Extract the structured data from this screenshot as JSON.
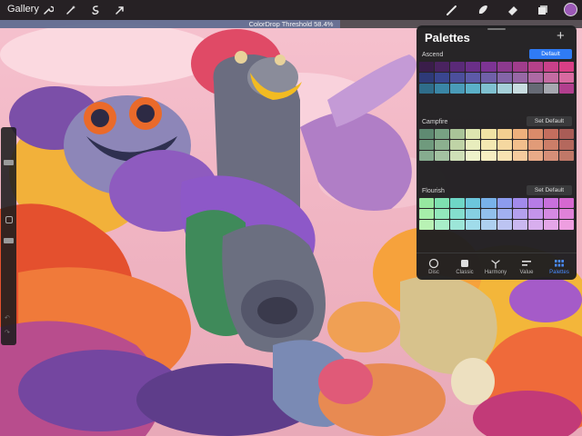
{
  "topbar": {
    "gallery_label": "Gallery",
    "current_color": "#9b59b6"
  },
  "threshold": {
    "text": "ColorDrop Threshold 58.4%",
    "value_percent": 58.4
  },
  "panel": {
    "title": "Palettes",
    "palettes": [
      {
        "name": "Ascend",
        "button_label": "Default",
        "is_default": true,
        "colors": [
          "#3a1d4a",
          "#4a2360",
          "#5a2a78",
          "#6a2f88",
          "#7d3494",
          "#8c3a8e",
          "#a03d8c",
          "#b5418a",
          "#c9418a",
          "#d93f86",
          "#2e3a78",
          "#3a4690",
          "#4c4f9c",
          "#5d5aa8",
          "#7060a8",
          "#8465a8",
          "#9868a6",
          "#ad6aa4",
          "#c46ba2",
          "#d86aa0",
          "#2f6d8a",
          "#3a86a6",
          "#4a9bb8",
          "#5bb0c8",
          "#7fc0d0",
          "#a5cfd8",
          "#c8dce0",
          "#666a75",
          "#a6a8b0",
          "#b23f8e"
        ]
      },
      {
        "name": "Campfire",
        "button_label": "Set Default",
        "is_default": false,
        "colors": [
          "#5f8a72",
          "#78a283",
          "#a9c498",
          "#dde6b0",
          "#f1e3a4",
          "#f3cf90",
          "#eeb07c",
          "#d98b6a",
          "#c46e5e",
          "#a95c56",
          "#6f9a7d",
          "#8cb08f",
          "#bfd3a6",
          "#e8edbd",
          "#f4e8b2",
          "#f5d8a0",
          "#f2bf8c",
          "#e19b78",
          "#cc7e68",
          "#b4685d",
          "#86ac8f",
          "#a3c2a1",
          "#cfdfb7",
          "#eef2ca",
          "#f7eec2",
          "#f8e2b2",
          "#f6cb9e",
          "#e9ab88",
          "#d68f78",
          "#c07868"
        ]
      },
      {
        "name": "Flourish",
        "button_label": "Set Default",
        "is_default": false,
        "colors": [
          "#96e8a0",
          "#7ee0b0",
          "#6ed6c6",
          "#6cc6dc",
          "#78b2ea",
          "#8c9cee",
          "#a28aec",
          "#b67ce6",
          "#c870dc",
          "#d668d0",
          "#a6eeaa",
          "#92e8bc",
          "#84dece",
          "#86d0e2",
          "#92c0ec",
          "#a2b0f0",
          "#b4a0ee",
          "#c494ea",
          "#d48ae2",
          "#e082d8",
          "#b8f2b4",
          "#a8eec8",
          "#9ce6d8",
          "#a0dcea",
          "#aed0f0",
          "#bcc4f2",
          "#cab8f0",
          "#d8aeee",
          "#e4a6e8",
          "#ee9ee0"
        ]
      }
    ],
    "tabs": [
      {
        "label": "Disc",
        "icon": "disc-icon",
        "active": false
      },
      {
        "label": "Classic",
        "icon": "classic-square-icon",
        "active": false
      },
      {
        "label": "Harmony",
        "icon": "harmony-icon",
        "active": false
      },
      {
        "label": "Value",
        "icon": "value-sliders-icon",
        "active": false
      },
      {
        "label": "Palettes",
        "icon": "palettes-grid-icon",
        "active": true
      }
    ]
  },
  "toolbar": {
    "left_tools": [
      "wrench-icon",
      "magic-wand-icon",
      "selection-icon",
      "transform-arrow-icon"
    ],
    "right_tools": [
      "brush-icon",
      "smudge-icon",
      "eraser-icon",
      "layers-icon"
    ]
  }
}
